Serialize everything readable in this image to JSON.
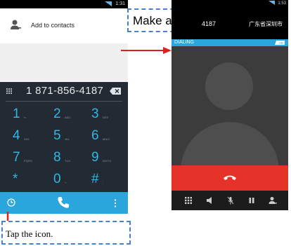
{
  "left_phone": {
    "status_time": "1:31",
    "add_contact_label": "Add to contacts",
    "dialed_number": "1 871-856-4187",
    "keys": [
      {
        "digit": "1",
        "letters": "∞"
      },
      {
        "digit": "2",
        "letters": "ABC"
      },
      {
        "digit": "3",
        "letters": "DEF"
      },
      {
        "digit": "4",
        "letters": "GHI"
      },
      {
        "digit": "5",
        "letters": "JKL"
      },
      {
        "digit": "6",
        "letters": "MNO"
      },
      {
        "digit": "7",
        "letters": "PQRS"
      },
      {
        "digit": "8",
        "letters": "TUV"
      },
      {
        "digit": "9",
        "letters": "WXYZ"
      },
      {
        "digit": "*",
        "letters": ","
      },
      {
        "digit": "0",
        "letters": "+"
      },
      {
        "digit": "#",
        "letters": ";"
      }
    ]
  },
  "right_phone": {
    "status_time": "1:53",
    "number_partial": "4187",
    "location": "广东省深圳市",
    "dialing_label": "DIALING",
    "hd_label": "HD"
  },
  "annotations": {
    "make_call": "Make a call",
    "tap_icon": "Tap the icon."
  },
  "colors": {
    "accent_blue": "#2aa6dd",
    "key_blue": "#33b5e5",
    "end_call_red": "#e5332a",
    "callout_border": "#4a80c8",
    "arrow_red": "#e02020"
  },
  "icons": {
    "add_contact": "person-add-icon",
    "menu_grid": "dialpad-grid-icon",
    "backspace": "backspace-icon",
    "history": "call-history-icon",
    "call": "phone-icon",
    "overflow": "more-vert-icon",
    "end_call": "end-call-icon",
    "controls": [
      "dialpad-icon",
      "speaker-icon",
      "mute-icon",
      "hold-icon",
      "add-call-icon"
    ]
  }
}
